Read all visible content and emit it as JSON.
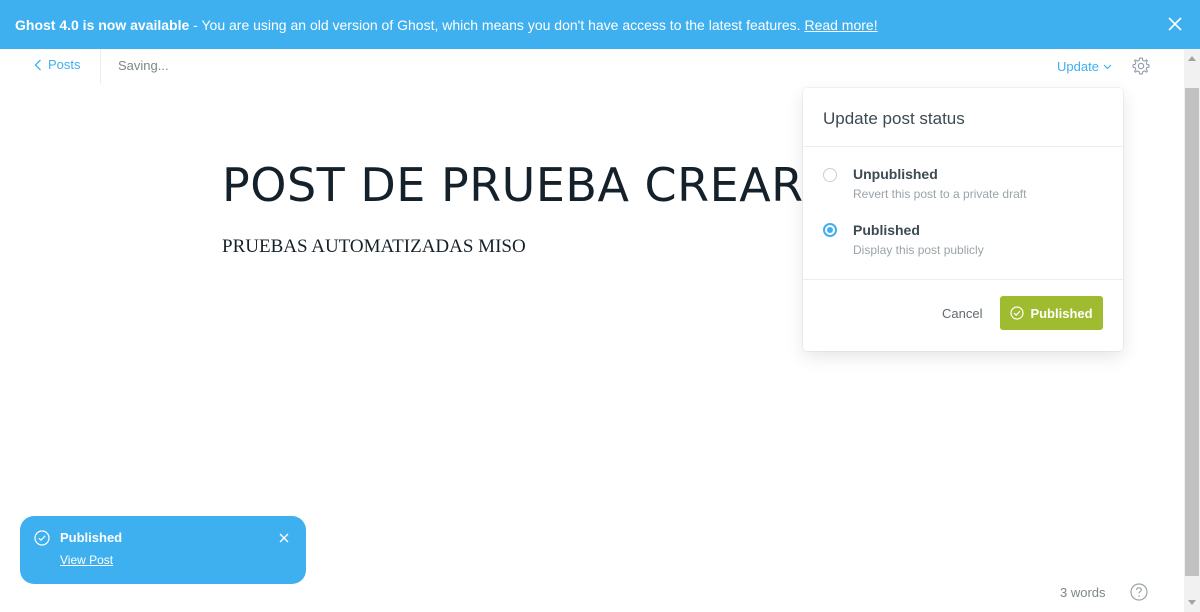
{
  "banner": {
    "bold": "Ghost 4.0 is now available",
    "text": " - You are using an old version of Ghost, which means you don't have access to the latest features. ",
    "link": "Read more!",
    "close_icon": "close-icon"
  },
  "header": {
    "back_label": "Posts",
    "status": "Saving...",
    "update_label": "Update",
    "settings_icon": "gear-icon"
  },
  "post": {
    "title": "POST DE PRUEBA CREAR",
    "body": "PRUEBAS AUTOMATIZADAS MISO"
  },
  "dropdown": {
    "title": "Update post status",
    "options": [
      {
        "label": "Unpublished",
        "desc": "Revert this post to a private draft",
        "checked": false
      },
      {
        "label": "Published",
        "desc": "Display this post publicly",
        "checked": true
      }
    ],
    "cancel_label": "Cancel",
    "confirm_label": "Published"
  },
  "toast": {
    "title": "Published",
    "link": "View Post"
  },
  "footer": {
    "word_count": "3 words"
  },
  "colors": {
    "accent": "#3eb0ef",
    "publish_green": "#9fbb2f",
    "text_dark": "#15212a"
  }
}
